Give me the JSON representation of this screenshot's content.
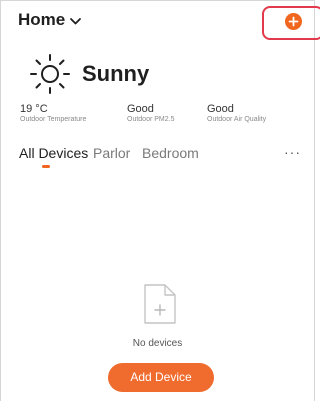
{
  "header": {
    "home_label": "Home",
    "add_icon": "plus-circle-icon",
    "accent_color": "#f0661f"
  },
  "weather": {
    "icon": "sun-icon",
    "condition": "Sunny",
    "stats": [
      {
        "value": "19 °C",
        "label": "Outdoor Temperature"
      },
      {
        "value": "Good",
        "label": "Outdoor PM2.5"
      },
      {
        "value": "Good",
        "label": "Outdoor Air Quality"
      }
    ]
  },
  "tabs": [
    {
      "label": "All Devices",
      "active": true
    },
    {
      "label": "Parlor",
      "active": false
    },
    {
      "label": "Bedroom",
      "active": false
    }
  ],
  "more_label": "···",
  "empty_state": {
    "icon": "empty-document-plus-icon",
    "message": "No devices"
  },
  "add_device_button": "Add Device"
}
